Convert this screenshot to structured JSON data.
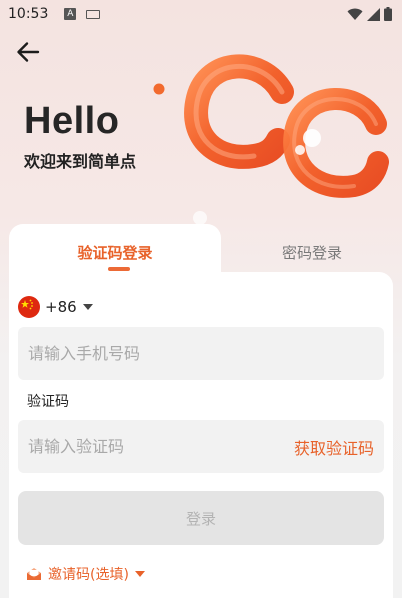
{
  "status_bar": {
    "time": "10:53",
    "input_indicator": "A"
  },
  "header": {
    "title": "Hello",
    "subtitle": "欢迎来到简单点"
  },
  "tabs": [
    {
      "label": "验证码登录",
      "active": true
    },
    {
      "label": "密码登录",
      "active": false
    }
  ],
  "country": {
    "code": "+86",
    "flag": "china-flag-icon"
  },
  "phone_field": {
    "placeholder": "请输入手机号码",
    "value": ""
  },
  "code_section": {
    "label": "验证码",
    "placeholder": "请输入验证码",
    "value": "",
    "get_code_label": "获取验证码"
  },
  "login_button": {
    "label": "登录",
    "enabled": false
  },
  "invite": {
    "label": "邀请码(选填)"
  },
  "colors": {
    "accent": "#e8622a",
    "button_disabled_bg": "#e4e4e4",
    "field_bg": "#f2f2f2"
  }
}
